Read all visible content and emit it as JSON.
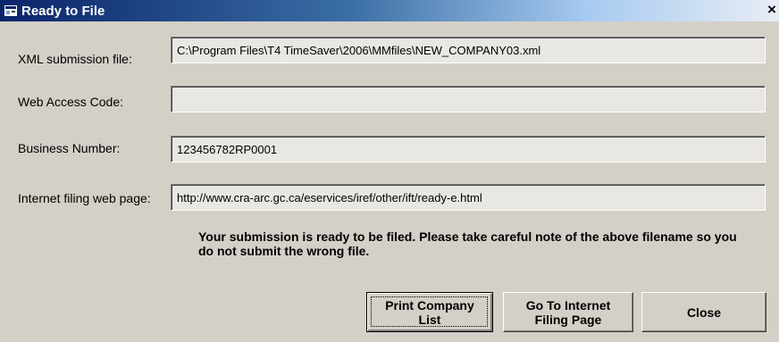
{
  "window": {
    "title": "Ready to File",
    "close_glyph": "×"
  },
  "fields": [
    {
      "label": "XML submission file:",
      "value": "C:\\Program Files\\T4 TimeSaver\\2006\\MMfiles\\NEW_COMPANY03.xml"
    },
    {
      "label": "Web Access Code:",
      "value": ""
    },
    {
      "label": "Business Number:",
      "value": "123456782RP0001"
    },
    {
      "label": "Internet filing web page:",
      "value": "http://www.cra-arc.gc.ca/eservices/iref/other/ift/ready-e.html"
    }
  ],
  "message": "Your submission is ready to be filed.  Please take careful note of the above filename so you do not submit the wrong file.",
  "buttons": {
    "print": "Print Company\nList",
    "goto": "Go To Internet\nFiling Page",
    "close": "Close"
  },
  "icons": {
    "title_icon": "window-app-icon"
  }
}
